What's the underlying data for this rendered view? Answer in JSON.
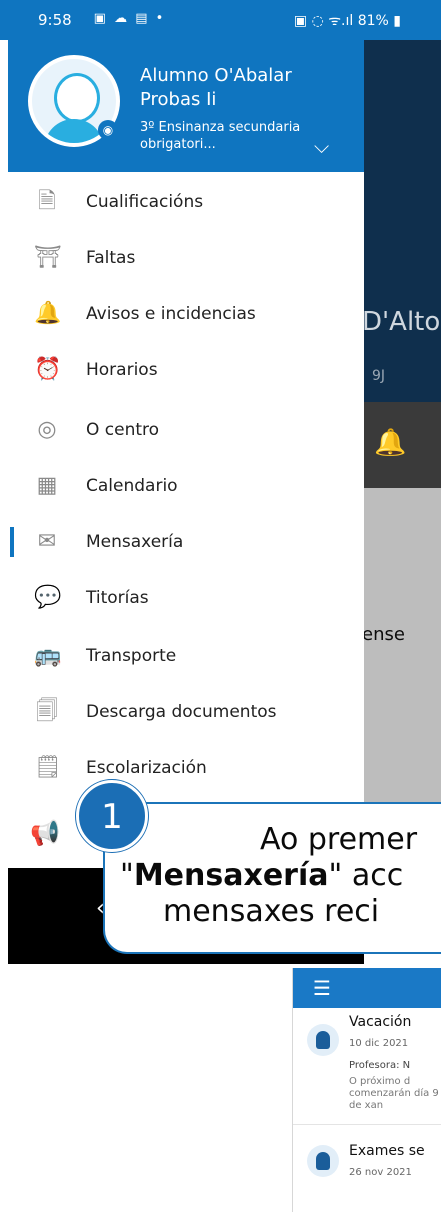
{
  "status": {
    "time": "9:58",
    "left_icons": "▣ ☁ in •",
    "right": "81%"
  },
  "background_app": {
    "title_fragment": "D'Alto",
    "sub": "9J",
    "body_fragment": "ense"
  },
  "user": {
    "name": "Alumno O'Abalar Probas Ii",
    "course": "3º Ensinanza secundaria obrigatori..."
  },
  "menu": [
    {
      "label": "Cualificacións",
      "icon": "document-icon"
    },
    {
      "label": "Faltas",
      "icon": "desk-icon"
    },
    {
      "label": "Avisos e incidencias",
      "icon": "bell-icon"
    },
    {
      "label": "Horarios",
      "icon": "alarm-clock-icon"
    },
    {
      "label": "O centro",
      "icon": "location-icon"
    },
    {
      "label": "Calendario",
      "icon": "calendar-icon"
    },
    {
      "label": "Mensaxería",
      "icon": "envelope-icon"
    },
    {
      "label": "Titorías",
      "icon": "chat-bubble-icon"
    },
    {
      "label": "Transporte",
      "icon": "bus-icon"
    },
    {
      "label": "Descarga documentos",
      "icon": "pdf-icon"
    },
    {
      "label": "Escolarización",
      "icon": "certificate-icon"
    }
  ],
  "callout": {
    "number": "1",
    "line1": "Ao premer",
    "bold": "Mensaxería",
    "line2_rest": "\" acc",
    "line3": "mensaxes reci"
  },
  "preview": {
    "messages": [
      {
        "title": "Vacación",
        "date": "10 dic 2021",
        "prof_label": "Profesora: N",
        "body": "O próximo d comenzarán día 9 de xan"
      },
      {
        "title": "Exames se",
        "date": "26 nov 2021"
      }
    ]
  }
}
